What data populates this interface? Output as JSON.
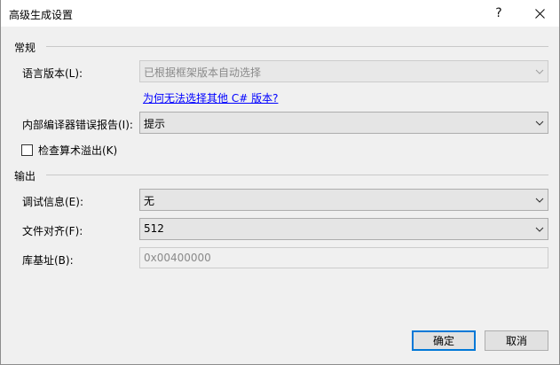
{
  "window": {
    "title": "高级生成设置",
    "help": "?"
  },
  "groups": {
    "general": "常规",
    "output": "输出"
  },
  "general": {
    "lang_label": "语言版本(L):",
    "lang_value": "已根据框架版本自动选择",
    "lang_link": "为何无法选择其他 C# 版本?",
    "report_label": "内部编译器错误报告(I):",
    "report_value": "提示",
    "overflow_label": "检查算术溢出(K)",
    "overflow_checked": false
  },
  "output": {
    "debug_label": "调试信息(E):",
    "debug_value": "无",
    "align_label": "文件对齐(F):",
    "align_value": "512",
    "base_label": "库基址(B):",
    "base_value": "0x00400000"
  },
  "buttons": {
    "ok": "确定",
    "cancel": "取消"
  }
}
